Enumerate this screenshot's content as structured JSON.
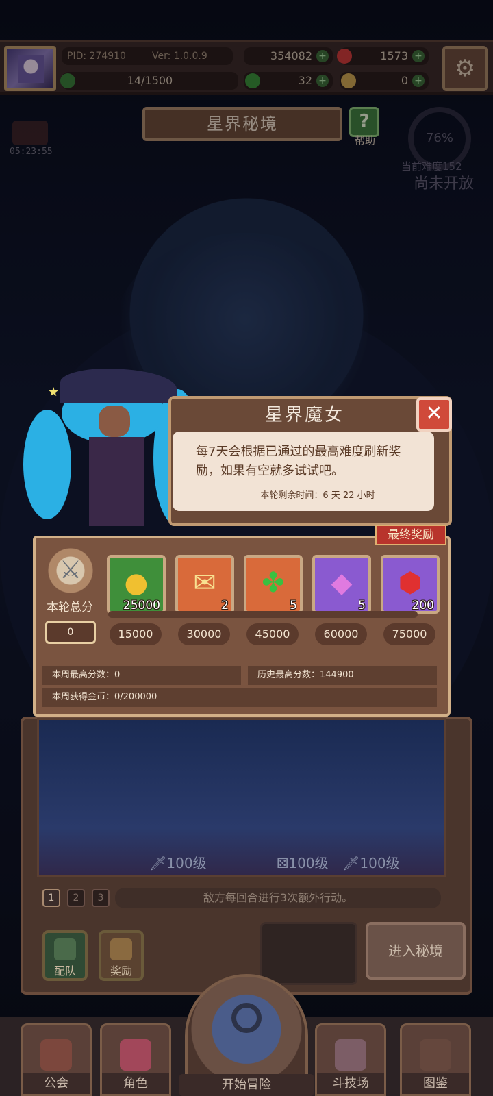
{
  "topbar": {
    "pid": "PID: 274910",
    "version": "Ver: 1.0.0.9",
    "xp": "14/1500",
    "gold": "354082",
    "ruby": "1573",
    "clover": "32",
    "fragments": "0",
    "icons": {
      "settings": "gear-icon",
      "gold": "coin-icon",
      "ruby": "ruby-icon",
      "clover": "clover-icon",
      "fragment": "fragment-icon"
    }
  },
  "header": {
    "title": "星界秘境",
    "help_label": "帮助",
    "help_glyph": "?",
    "timer": "05:23:55",
    "progress": "76%",
    "difficulty": "当前难度152",
    "not_open": "尚未开放"
  },
  "dialog": {
    "title": "星界魔女",
    "description": "每7天会根据已通过的最高难度刷新奖励，如果有空就多试试吧。",
    "remaining_time": "本轮剩余时间：6 天 22 小时",
    "close_glyph": "✕"
  },
  "rewards": {
    "final_tag": "最终奖励",
    "total_label": "本轮总分",
    "total_value": "0",
    "items": [
      {
        "icon": "gold-coin-icon",
        "count": "25000",
        "milestone": "15000",
        "color": "#3f8f3a"
      },
      {
        "icon": "mail-icon",
        "count": "2",
        "milestone": "30000",
        "color": "#d96a3a"
      },
      {
        "icon": "clover-icon",
        "count": "5",
        "milestone": "45000",
        "color": "#d96a3a"
      },
      {
        "icon": "crystal-icon",
        "count": "5",
        "milestone": "60000",
        "color": "#8a5ad0"
      },
      {
        "icon": "ruby-icon",
        "count": "200",
        "milestone": "75000",
        "color": "#8a5ad0"
      }
    ],
    "week_best": "本周最高分数：0",
    "history_best": "历史最高分数：144900",
    "week_gold": "本周获得金币：0/200000"
  },
  "stage": {
    "level_1": "100级",
    "level_2": "100级",
    "level_3": "100级",
    "pages": [
      "1",
      "2",
      "3"
    ],
    "hint": "敌方每回合进行3次额外行动。",
    "team_label": "配队",
    "reward_label": "奖励",
    "enter_label": "进入秘境"
  },
  "nav": {
    "guild": "公会",
    "character": "角色",
    "adventure": "开始冒险",
    "arena": "斗技场",
    "codex": "图鉴"
  }
}
